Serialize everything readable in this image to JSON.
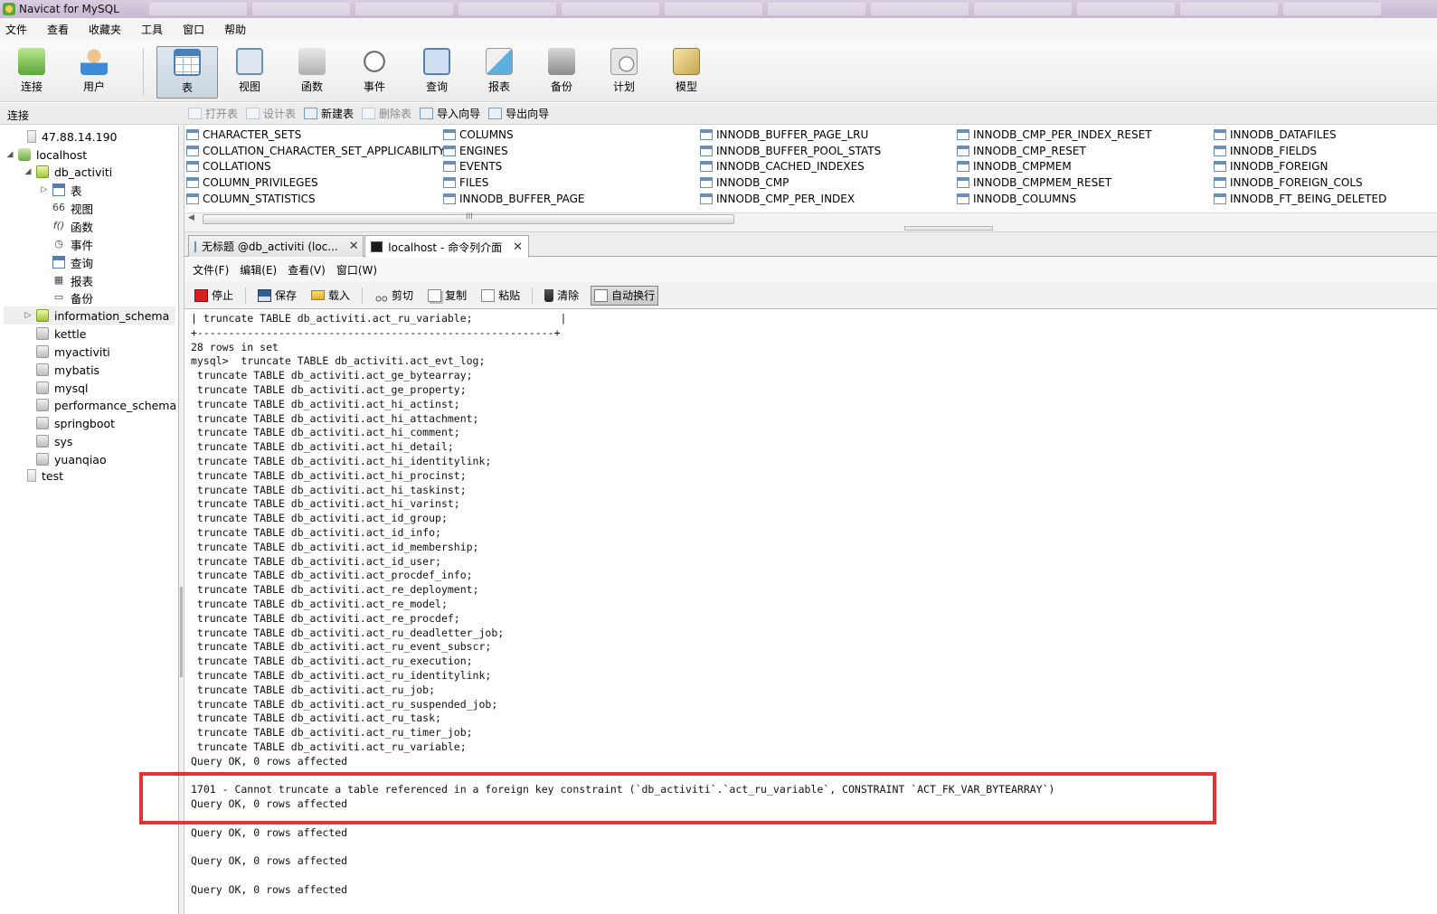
{
  "window": {
    "title": "Navicat for MySQL"
  },
  "menubar": {
    "items": [
      "文件",
      "查看",
      "收藏夹",
      "工具",
      "窗口",
      "帮助"
    ]
  },
  "toolbar": {
    "buttons": [
      {
        "label": "连接",
        "icon": "connection-icon"
      },
      {
        "label": "用户",
        "icon": "user-icon"
      },
      {
        "label": "表",
        "icon": "table-icon",
        "active": true
      },
      {
        "label": "视图",
        "icon": "view-icon"
      },
      {
        "label": "函数",
        "icon": "function-icon"
      },
      {
        "label": "事件",
        "icon": "event-icon"
      },
      {
        "label": "查询",
        "icon": "query-icon"
      },
      {
        "label": "报表",
        "icon": "report-icon"
      },
      {
        "label": "备份",
        "icon": "backup-icon"
      },
      {
        "label": "计划",
        "icon": "schedule-icon"
      },
      {
        "label": "模型",
        "icon": "model-icon"
      }
    ]
  },
  "connection_panel": {
    "label": "连接"
  },
  "object_toolbar": {
    "open_table": "打开表",
    "design_table": "设计表",
    "new_table": "新建表",
    "delete_table": "删除表",
    "import_wizard": "导入向导",
    "export_wizard": "导出向导"
  },
  "tree": {
    "server_remote": "47.88.14.190",
    "localhost": "localhost",
    "db_activiti": "db_activiti",
    "children": {
      "tables": "表",
      "views": "视图",
      "functions": "函数",
      "events": "事件",
      "queries": "查询",
      "reports": "报表",
      "backups": "备份"
    },
    "databases": [
      "information_schema",
      "kettle",
      "myactiviti",
      "mybatis",
      "mysql",
      "performance_schema",
      "springboot",
      "sys",
      "yuanqiao"
    ],
    "server_test": "test"
  },
  "object_list": {
    "columns": [
      [
        "CHARACTER_SETS",
        "COLLATION_CHARACTER_SET_APPLICABILITY",
        "COLLATIONS",
        "COLUMN_PRIVILEGES",
        "COLUMN_STATISTICS"
      ],
      [
        "COLUMNS",
        "ENGINES",
        "EVENTS",
        "FILES",
        "INNODB_BUFFER_PAGE"
      ],
      [
        "INNODB_BUFFER_PAGE_LRU",
        "INNODB_BUFFER_POOL_STATS",
        "INNODB_CACHED_INDEXES",
        "INNODB_CMP",
        "INNODB_CMP_PER_INDEX"
      ],
      [
        "INNODB_CMP_PER_INDEX_RESET",
        "INNODB_CMP_RESET",
        "INNODB_CMPMEM",
        "INNODB_CMPMEM_RESET",
        "INNODB_COLUMNS"
      ],
      [
        "INNODB_DATAFILES",
        "INNODB_FIELDS",
        "INNODB_FOREIGN",
        "INNODB_FOREIGN_COLS",
        "INNODB_FT_BEING_DELETED"
      ]
    ],
    "scroll_grip": "III"
  },
  "doc_tabs": {
    "tab1": "无标题 @db_activiti (loc...",
    "tab2": "localhost - 命令列介面"
  },
  "console_menu": {
    "items": [
      "文件(F)",
      "编辑(E)",
      "查看(V)",
      "窗口(W)"
    ]
  },
  "console_toolbar": {
    "stop": "停止",
    "save": "保存",
    "load": "载入",
    "cut": "剪切",
    "copy": "复制",
    "paste": "粘贴",
    "clear": "清除",
    "auto_wrap": "自动换行"
  },
  "console": {
    "output": "| truncate TABLE db_activiti.act_ru_variable;              |\n+---------------------------------------------------------+\n28 rows in set\nmysql>  truncate TABLE db_activiti.act_evt_log;\n truncate TABLE db_activiti.act_ge_bytearray;\n truncate TABLE db_activiti.act_ge_property;\n truncate TABLE db_activiti.act_hi_actinst;\n truncate TABLE db_activiti.act_hi_attachment;\n truncate TABLE db_activiti.act_hi_comment;\n truncate TABLE db_activiti.act_hi_detail;\n truncate TABLE db_activiti.act_hi_identitylink;\n truncate TABLE db_activiti.act_hi_procinst;\n truncate TABLE db_activiti.act_hi_taskinst;\n truncate TABLE db_activiti.act_hi_varinst;\n truncate TABLE db_activiti.act_id_group;\n truncate TABLE db_activiti.act_id_info;\n truncate TABLE db_activiti.act_id_membership;\n truncate TABLE db_activiti.act_id_user;\n truncate TABLE db_activiti.act_procdef_info;\n truncate TABLE db_activiti.act_re_deployment;\n truncate TABLE db_activiti.act_re_model;\n truncate TABLE db_activiti.act_re_procdef;\n truncate TABLE db_activiti.act_ru_deadletter_job;\n truncate TABLE db_activiti.act_ru_event_subscr;\n truncate TABLE db_activiti.act_ru_execution;\n truncate TABLE db_activiti.act_ru_identitylink;\n truncate TABLE db_activiti.act_ru_job;\n truncate TABLE db_activiti.act_ru_suspended_job;\n truncate TABLE db_activiti.act_ru_task;\n truncate TABLE db_activiti.act_ru_timer_job;\n truncate TABLE db_activiti.act_ru_variable;\nQuery OK, 0 rows affected\n\n1701 - Cannot truncate a table referenced in a foreign key constraint (`db_activiti`.`act_ru_variable`, CONSTRAINT `ACT_FK_VAR_BYTEARRAY`)\nQuery OK, 0 rows affected\n\nQuery OK, 0 rows affected\n\nQuery OK, 0 rows affected\n\nQuery OK, 0 rows affected"
  },
  "colors": {
    "highlight": "#e23434",
    "active_toolbar": "#c9d4df"
  }
}
